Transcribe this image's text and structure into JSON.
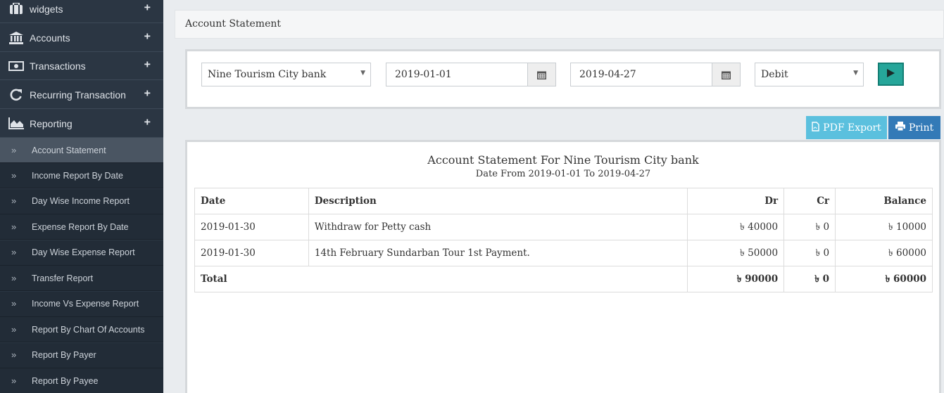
{
  "sidebar": {
    "menu": [
      {
        "label": "widgets",
        "icon": "briefcase-icon"
      },
      {
        "label": "Accounts",
        "icon": "bank-icon"
      },
      {
        "label": "Transactions",
        "icon": "money-icon"
      },
      {
        "label": "Recurring Transaction",
        "icon": "refresh-icon"
      },
      {
        "label": "Reporting",
        "icon": "area-chart-icon"
      }
    ],
    "plus": "+",
    "submenu_icon": "»",
    "submenu": [
      "Account Statement",
      "Income Report By Date",
      "Day Wise Income Report",
      "Expense Report By Date",
      "Day Wise Expense Report",
      "Transfer Report",
      "Income Vs Expense Report",
      "Report By Chart Of Accounts",
      "Report By Payer",
      "Report By Payee"
    ]
  },
  "header": {
    "title": "Account Statement"
  },
  "filters": {
    "account": "Nine Tourism City bank",
    "date_from": "2019-01-01",
    "date_to": "2019-04-27",
    "type": "Debit"
  },
  "actions": {
    "pdf_label": "PDF Export",
    "print_label": "Print"
  },
  "report": {
    "title": "Account Statement For Nine Tourism City bank",
    "subtitle": "Date From 2019-01-01 To 2019-04-27",
    "columns": [
      "Date",
      "Description",
      "Dr",
      "Cr",
      "Balance"
    ],
    "rows": [
      {
        "date": "2019-01-30",
        "description": "Withdraw for Petty cash",
        "dr": "৳ 40000",
        "cr": "৳ 0",
        "balance": "৳ 10000"
      },
      {
        "date": "2019-01-30",
        "description": "14th February Sundarban Tour 1st Payment.",
        "dr": "৳ 50000",
        "cr": "৳ 0",
        "balance": "৳ 60000"
      }
    ],
    "total": {
      "label": "Total",
      "dr": "৳ 90000",
      "cr": "৳ 0",
      "balance": "৳ 60000"
    }
  },
  "colors": {
    "sidebar": "#2b3643",
    "submenu": "#222c37",
    "active": "#4a5562",
    "teal": "#26a69a",
    "info": "#5bc0de",
    "primary": "#337ab7"
  }
}
